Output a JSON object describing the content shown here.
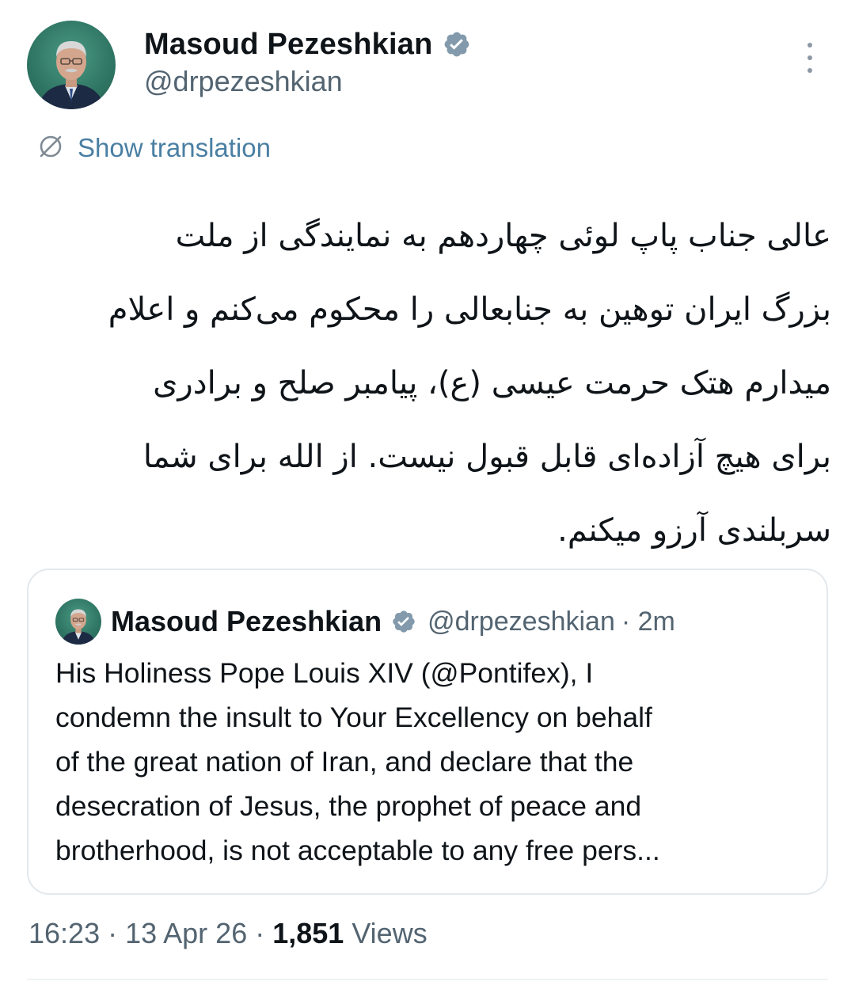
{
  "author": {
    "name": "Masoud Pezeshkian",
    "handle": "@drpezeshkian",
    "verified_color": "#829aab"
  },
  "tweet": {
    "show_translation_label": "Show translation",
    "body_lines": [
      "عالی جناب پاپ لوئی چهاردهم به نمایندگی از ملت",
      "بزرگ ایران توهین به جنابعالی را محکوم می‌کنم و اعلام",
      "میدارم هتک حرمت عیسی (ع)، پیامبر صلح و برادری",
      "برای هیچ آزاده‌ای قابل قبول نیست. از الله برای شما",
      "سربلندی آرزو میکنم."
    ]
  },
  "quoted_tweet": {
    "name": "Masoud Pezeshkian",
    "handle": "@drpezeshkian",
    "time": "· 2m",
    "text_lines": [
      "His Holiness Pope Louis XIV (@Pontifex), I",
      "condemn the insult to Your Excellency on behalf",
      "of the great nation of Iran, and declare that the",
      "desecration of Jesus, the prophet of peace and",
      "brotherhood, is not acceptable to any free pers..."
    ]
  },
  "meta": {
    "time": "16:23",
    "date": "13 Apr 26",
    "views_count": "1,851",
    "views_label": "Views"
  },
  "colors": {
    "link": "#4a7fa3",
    "secondary_text": "#536471",
    "primary_text": "#0f1419"
  },
  "icons": {
    "verified": "verified-badge-icon",
    "more": "more-vertical-icon",
    "translate": "translate-globe-icon"
  }
}
